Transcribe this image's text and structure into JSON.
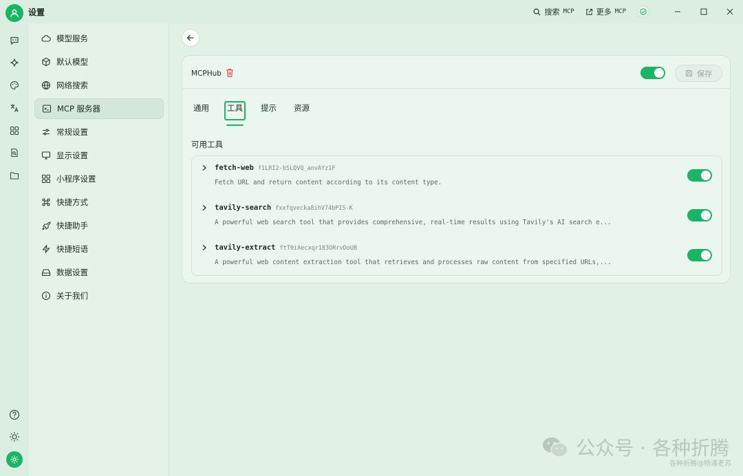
{
  "app": {
    "title": "设置"
  },
  "titlebar": {
    "search_label": "搜索",
    "search_mono": "MCP",
    "more_label": "更多",
    "more_mono": "MCP"
  },
  "rail": {
    "items": [
      "chat-icon",
      "sparkle-icon",
      "palette-icon",
      "translate-icon",
      "apps-icon",
      "doc-search-icon",
      "folder-icon"
    ],
    "bottom": [
      "help-icon",
      "theme-icon",
      "settings-icon"
    ]
  },
  "sidebar": {
    "items": [
      {
        "label": "模型服务",
        "icon": "cloud-icon"
      },
      {
        "label": "默认模型",
        "icon": "cube-icon"
      },
      {
        "label": "网络搜索",
        "icon": "globe-icon"
      },
      {
        "label": "MCP 服务器",
        "icon": "terminal-icon"
      },
      {
        "label": "常规设置",
        "icon": "sliders-icon"
      },
      {
        "label": "显示设置",
        "icon": "monitor-icon"
      },
      {
        "label": "小程序设置",
        "icon": "grid-icon"
      },
      {
        "label": "快捷方式",
        "icon": "command-icon"
      },
      {
        "label": "快捷助手",
        "icon": "rocket-icon"
      },
      {
        "label": "快捷短语",
        "icon": "zap-icon"
      },
      {
        "label": "数据设置",
        "icon": "drive-icon"
      },
      {
        "label": "关于我们",
        "icon": "info-icon"
      }
    ],
    "active_index": 3
  },
  "server": {
    "name": "MCPHub",
    "enabled": true,
    "save_label": "保存"
  },
  "tabs": [
    {
      "label": "通用"
    },
    {
      "label": "工具"
    },
    {
      "label": "提示"
    },
    {
      "label": "资源"
    }
  ],
  "active_tab": 1,
  "tools_section": {
    "title": "可用工具",
    "tools": [
      {
        "name": "fetch-web",
        "id": "f1LRI2-bSLQVQ_anvAYz1F",
        "desc": "Fetch URL and return content according to its content type.",
        "enabled": true
      },
      {
        "name": "tavily-search",
        "id": "fxxfqvecka8ihV74bPIS-K",
        "desc": "A powerful web search tool that provides comprehensive, real-time results using Tavily's AI search e...",
        "enabled": true
      },
      {
        "name": "tavily-extract",
        "id": "ftT0iAecxqr183ORrvDoUB",
        "desc": "A powerful web content extraction tool that retrieves and processes raw content from specified URLs,...",
        "enabled": true
      }
    ]
  },
  "watermark": {
    "main": "公众号 · 各种折腾",
    "sub": "各种折腾@杨浦老苏"
  },
  "colors": {
    "accent": "#1ab564",
    "background": "#dcede1",
    "sidebar": "#e4f2e8",
    "card": "#eaf6ee"
  }
}
